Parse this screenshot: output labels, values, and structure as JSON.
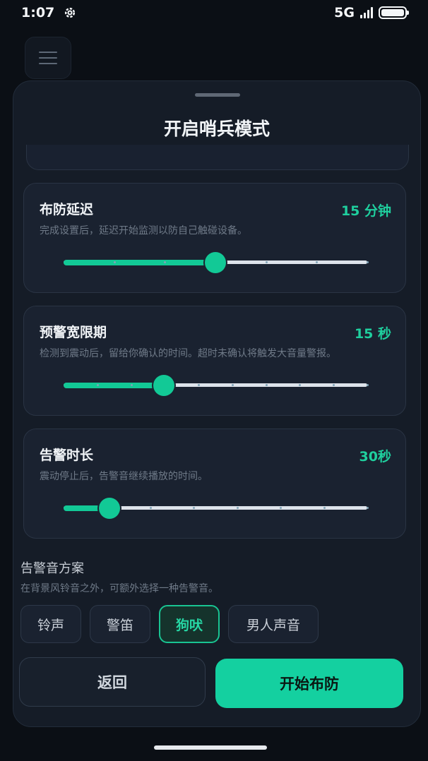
{
  "status_bar": {
    "time": "1:07",
    "network": "5G",
    "icons": [
      "settings-gear-icon",
      "signal-icon",
      "battery-icon"
    ]
  },
  "menu": {
    "icon": "hamburger-menu-icon"
  },
  "sheet": {
    "title": "开启哨兵模式",
    "settings": [
      {
        "title": "布防延迟",
        "value": "15 分钟",
        "description": "完成设置后，延迟开始监测以防自己触碰设备。",
        "slider_fraction": 0.5,
        "ticks": 6
      },
      {
        "title": "预警宽限期",
        "value": "15 秒",
        "description": "检测到震动后，留给你确认的时间。超时未确认将触发大音量警报。",
        "slider_fraction": 0.33,
        "ticks": 9
      },
      {
        "title": "告警时长",
        "value": "30秒",
        "description": "震动停止后，告警音继续播放的时间。",
        "slider_fraction": 0.15,
        "ticks": 7
      }
    ],
    "alarm_sound": {
      "title": "告警音方案",
      "description": "在背景风铃音之外，可额外选择一种告警音。",
      "options": [
        "铃声",
        "警笛",
        "狗吠",
        "男人声音"
      ],
      "selected": "狗吠"
    },
    "buttons": {
      "back": "返回",
      "arm": "开始布防"
    }
  },
  "colors": {
    "accent": "#12c996",
    "background": "#0b0f15",
    "card": "#1a2230",
    "muted_text": "#6f7a88"
  }
}
